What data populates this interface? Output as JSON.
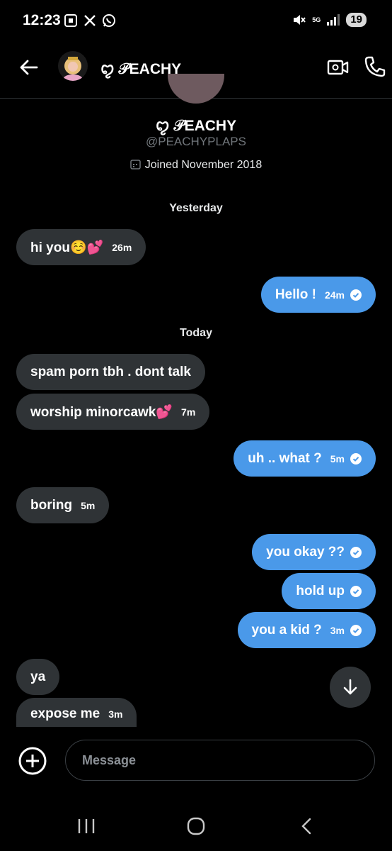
{
  "status_bar": {
    "time": "12:23",
    "network": "5G",
    "battery": "19"
  },
  "header": {
    "name": "ꨄ 𝒫EACHY"
  },
  "profile": {
    "name": "ꨄ 𝒫EACHY",
    "handle": "@PEACHYPLAPS",
    "joined": "Joined November 2018"
  },
  "separators": {
    "yesterday": "Yesterday",
    "today": "Today"
  },
  "messages": [
    {
      "text": "hi you☺️💕",
      "time": "26m",
      "dir": "in"
    },
    {
      "text": "Hello !",
      "time": "24m",
      "dir": "out"
    },
    {
      "text": "spam porn tbh . dont talk",
      "time": "",
      "dir": "in"
    },
    {
      "text": "worship minorcawk💕",
      "time": "7m",
      "dir": "in"
    },
    {
      "text": "uh .. what ?",
      "time": "5m",
      "dir": "out"
    },
    {
      "text": "boring",
      "time": "5m",
      "dir": "in"
    },
    {
      "text": "you okay ??",
      "time": "",
      "dir": "out"
    },
    {
      "text": "hold up",
      "time": "",
      "dir": "out"
    },
    {
      "text": "you a kid ?",
      "time": "3m",
      "dir": "out"
    },
    {
      "text": "ya",
      "time": "",
      "dir": "in"
    },
    {
      "text": "expose me",
      "time": "3m",
      "dir": "in"
    }
  ],
  "composer": {
    "placeholder": "Message"
  },
  "colors": {
    "background": "#000000",
    "incoming_bubble": "#2f3336",
    "outgoing_bubble": "#4a99e9",
    "muted_text": "#71767b"
  },
  "icons": {
    "back": "arrow-left-icon",
    "video": "video-camera-icon",
    "call": "phone-icon",
    "calendar": "calendar-icon",
    "check": "check-circle-icon",
    "scroll_down": "arrow-down-icon",
    "add": "plus-circle-icon"
  }
}
